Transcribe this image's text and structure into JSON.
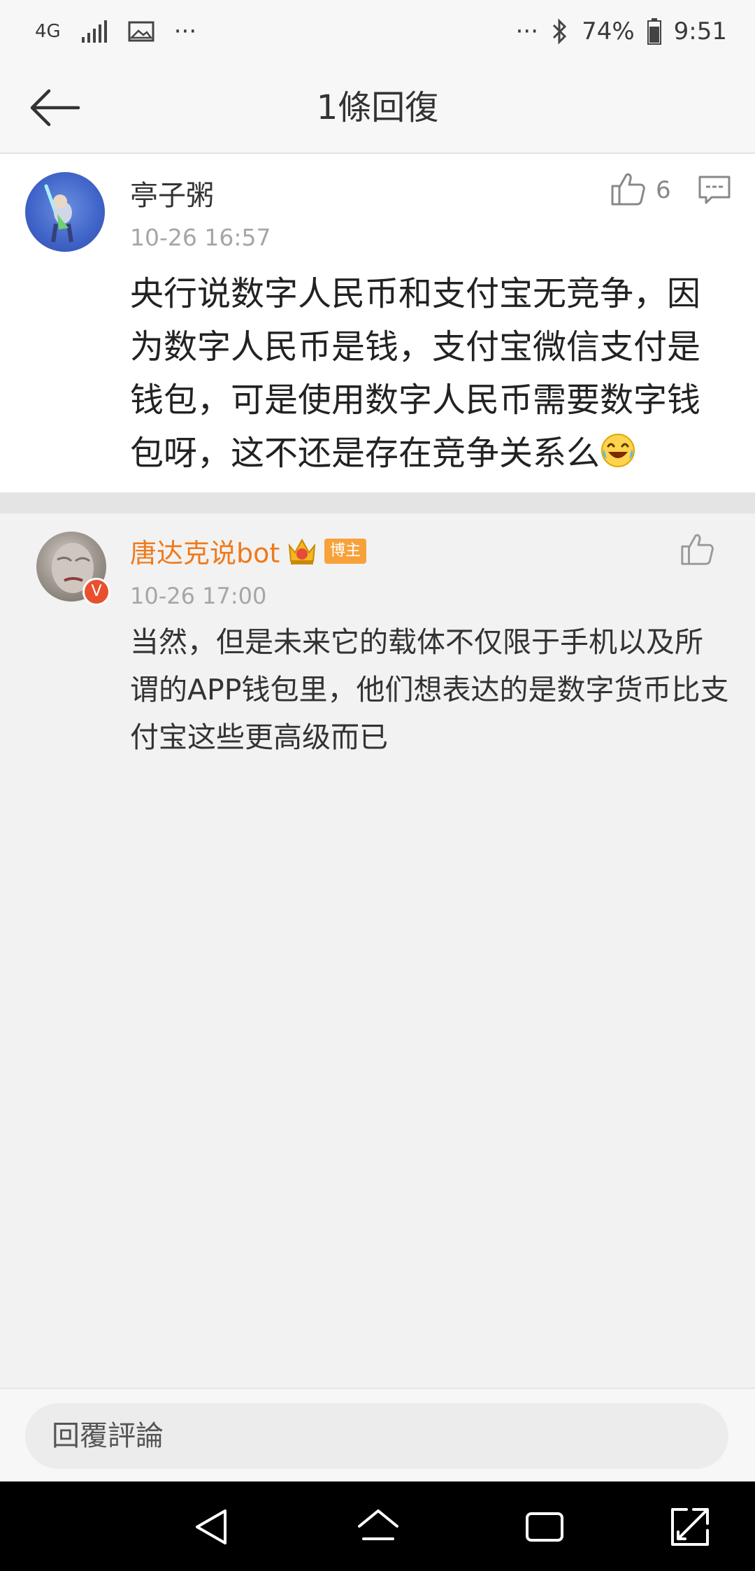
{
  "status_bar": {
    "network": "4G",
    "more_left": "···",
    "more_right": "···",
    "battery": "74%",
    "time": "9:51"
  },
  "header": {
    "title": "1條回復"
  },
  "main_comment": {
    "username": "亭子粥",
    "time": "10-26 16:57",
    "like_count": "6",
    "content": "央行说数字人民币和支付宝无竞争，因为数字人民币是钱，支付宝微信支付是钱包，可是使用数字人民币需要数字钱包呀，这不还是存在竞争关系么"
  },
  "reply": {
    "username": "唐达克说bot",
    "badge": "博主",
    "verified_mark": "V",
    "time": "10-26 17:00",
    "content": "当然，但是未来它的载体不仅限于手机以及所谓的APP钱包里，他们想表达的是数字货币比支付宝这些更高级而已"
  },
  "input": {
    "placeholder": "回覆評論"
  },
  "colors": {
    "username_highlight": "#ef7a1c",
    "badge_bg": "#f7a13a",
    "verified_badge": "#e8502e",
    "time_text": "#a6a6a6"
  },
  "icons": [
    "back-arrow-icon",
    "thumb-up-icon",
    "comment-icon",
    "laughing-emoji-icon",
    "crown-icon",
    "bluetooth-icon",
    "battery-icon",
    "signal-icon",
    "image-icon",
    "nav-back-icon",
    "nav-home-icon",
    "nav-recent-icon",
    "nav-expand-icon"
  ]
}
